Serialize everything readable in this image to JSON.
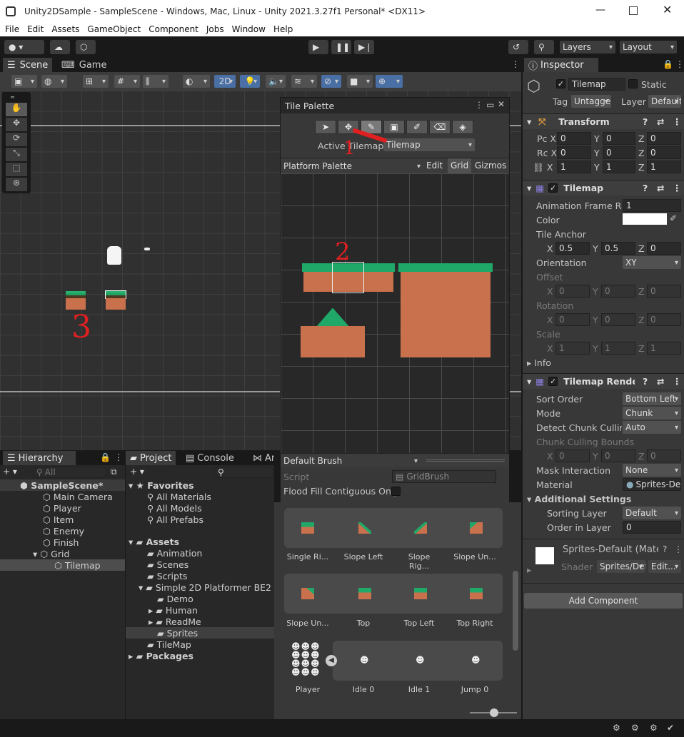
{
  "window": {
    "title": "Unity2DSample - SampleScene - Windows, Mac, Linux - Unity 2021.3.27f1 Personal* <DX11>"
  },
  "menu": [
    "File",
    "Edit",
    "Assets",
    "GameObject",
    "Component",
    "Jobs",
    "Window",
    "Help"
  ],
  "toolbar": {
    "layers": "Layers",
    "layout": "Layout"
  },
  "scene": {
    "tabs": [
      "Scene",
      "Game"
    ],
    "mode_2d": "2D"
  },
  "palette": {
    "title": "Tile Palette",
    "active_tilemap_label": "Active Tilemap",
    "active_tilemap_value": "Tilemap",
    "palette_name": "Platform Palette",
    "edit": "Edit",
    "grid": "Grid",
    "gizmos": "Gizmos",
    "brush": "Default Brush",
    "script_label": "Script",
    "script_value": "GridBrush",
    "flood_fill": "Flood Fill Contiguous Only",
    "tiles_row1": [
      "Single Ri...",
      "Slope Left",
      "Slope Rig...",
      "Slope Un..."
    ],
    "tiles_row2": [
      "Slope Un...",
      "Top",
      "Top Left",
      "Top Right"
    ],
    "tiles_row3": [
      "Player",
      "Idle 0",
      "Idle 1",
      "Jump 0"
    ]
  },
  "hierarchy": {
    "tab": "Hierarchy",
    "search": "All",
    "items": [
      "SampleScene*",
      "Main Camera",
      "Player",
      "Item",
      "Enemy",
      "Finish",
      "Grid",
      "Tilemap"
    ]
  },
  "project": {
    "tabs": [
      "Project",
      "Console",
      "Anim"
    ],
    "favorites": "Favorites",
    "fav_items": [
      "All Materials",
      "All Models",
      "All Prefabs"
    ],
    "assets": "Assets",
    "asset_items": [
      "Animation",
      "Scenes",
      "Scripts",
      "Simple 2D Platformer BE2",
      "Demo",
      "Human",
      "ReadMe",
      "Sprites",
      "TileMap"
    ],
    "packages": "Packages"
  },
  "inspector": {
    "tab": "Inspector",
    "object_name": "Tilemap",
    "static": "Static",
    "tag_label": "Tag",
    "tag_value": "Untagged",
    "layer_label": "Layer",
    "layer_value": "Default",
    "transform": {
      "title": "Transform",
      "pos": [
        "0",
        "0",
        "0"
      ],
      "rot": [
        "0",
        "0",
        "0"
      ],
      "scale": [
        "1",
        "1",
        "1"
      ]
    },
    "tilemap": {
      "title": "Tilemap",
      "anim_rate_label": "Animation Frame Rate",
      "anim_rate": "1",
      "color_label": "Color",
      "anchor_label": "Tile Anchor",
      "anchor": [
        "0.5",
        "0.5",
        "0"
      ],
      "orientation_label": "Orientation",
      "orientation": "XY",
      "offset_label": "Offset",
      "offset": [
        "0",
        "0",
        "0"
      ],
      "rotation_label": "Rotation",
      "rotation": [
        "0",
        "0",
        "0"
      ],
      "scale_label": "Scale",
      "scale": [
        "1",
        "1",
        "1"
      ],
      "info": "Info"
    },
    "renderer": {
      "title": "Tilemap Renderer",
      "sort_order_label": "Sort Order",
      "sort_order": "Bottom Left",
      "mode_label": "Mode",
      "mode": "Chunk",
      "detect_label": "Detect Chunk Culling",
      "detect": "Auto",
      "bounds_label": "Chunk Culling Bounds",
      "bounds": [
        "0",
        "0",
        "0"
      ],
      "mask_label": "Mask Interaction",
      "mask": "None",
      "material_label": "Material",
      "material": "Sprites-Default",
      "additional": "Additional Settings",
      "sorting_layer_label": "Sorting Layer",
      "sorting_layer": "Default",
      "order_label": "Order in Layer",
      "order": "0"
    },
    "material": {
      "name": "Sprites-Default (Material)",
      "shader_label": "Shader",
      "shader": "Sprites/Default",
      "edit": "Edit..."
    },
    "add_component": "Add Component"
  },
  "annotations": [
    "1",
    "2",
    "3"
  ]
}
